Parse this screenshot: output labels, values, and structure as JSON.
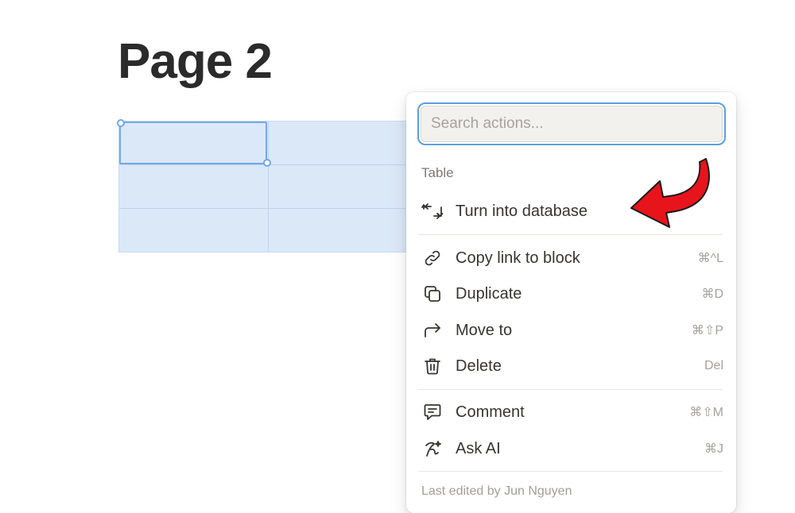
{
  "page": {
    "title": "Page 2"
  },
  "menu": {
    "search": {
      "placeholder": "Search actions..."
    },
    "section_label": "Table",
    "items": [
      {
        "label": "Turn into database",
        "icon": "turn-into-icon",
        "shortcut": ""
      },
      {
        "label": "Copy link to block",
        "icon": "link-icon",
        "shortcut": "⌘^L"
      },
      {
        "label": "Duplicate",
        "icon": "duplicate-icon",
        "shortcut": "⌘D"
      },
      {
        "label": "Move to",
        "icon": "move-arrow-icon",
        "shortcut": "⌘⇧P"
      },
      {
        "label": "Delete",
        "icon": "trash-icon",
        "shortcut": "Del"
      },
      {
        "label": "Comment",
        "icon": "comment-icon",
        "shortcut": "⌘⇧M"
      },
      {
        "label": "Ask AI",
        "icon": "ai-sparkle-icon",
        "shortcut": "⌘J"
      }
    ],
    "footer": "Last edited by Jun Nguyen"
  },
  "colors": {
    "accent": "#5e9ee0",
    "table_fill": "#dbe8f8",
    "annotation_arrow": "#e8141c"
  }
}
